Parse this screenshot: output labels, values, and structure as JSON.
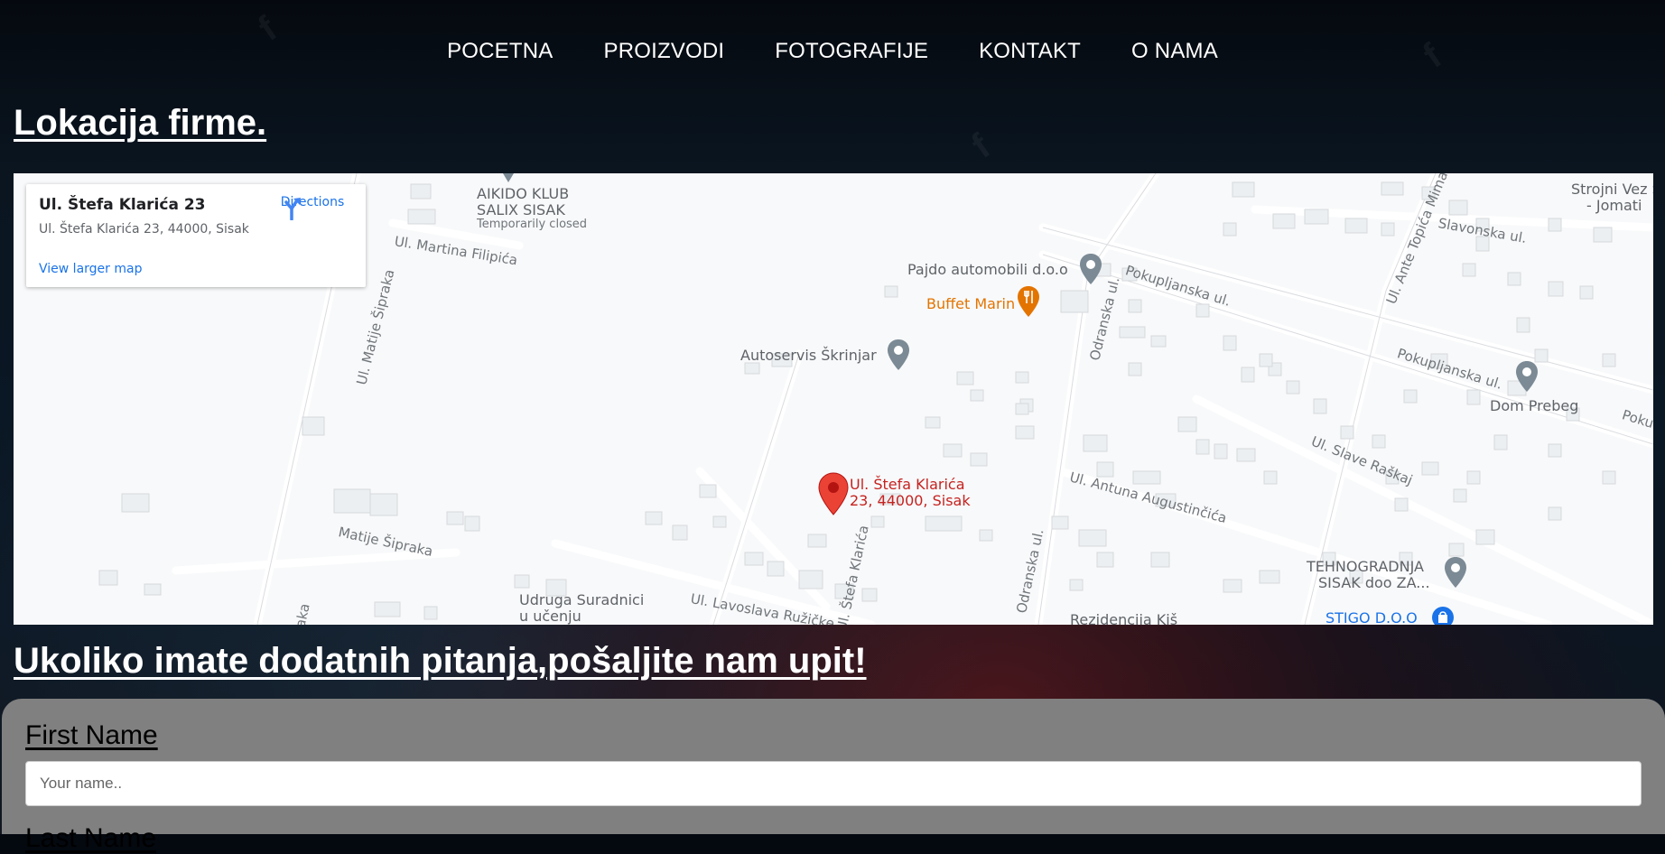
{
  "nav": {
    "items": [
      "POCETNA",
      "PROIZVODI",
      "FOTOGRAFIJE",
      "KONTAKT",
      "O NAMA"
    ]
  },
  "location_heading": "Lokacija firme.",
  "map": {
    "card": {
      "title": "Ul. Štefa Klarića 23",
      "address": "Ul. Štefa Klarića 23, 44000, Sisak",
      "directions": "Directions",
      "larger_map": "View larger map"
    },
    "pin_label_1": "Ul. Štefa Klarića",
    "pin_label_2": "23, 44000, Sisak",
    "places": {
      "aikido_1": "AIKIDO KLUB",
      "aikido_2": "SALIX SISAK",
      "aikido_status": "Temporarily closed",
      "pajdo": "Pajdo automobili d.o.o",
      "buffet": "Buffet Marin",
      "autoservis": "Autoservis Škrinjar",
      "dom_prebeg": "Dom Prebeg",
      "tehno_1": "TEHNOGRADNJA",
      "tehno_2": "SISAK doo ZA...",
      "stigo": "STIGO D.O.O",
      "udruga_1": "Udruga Suradnici",
      "udruga_2": "u učenju",
      "rezidencija": "Rezidencija Kiš",
      "strojni_1": "Strojni Vez S",
      "strojni_2": "- Jomati"
    },
    "streets": {
      "martina": "Ul. Martina Filipića",
      "matije_v": "Ul. Matije Šipraka",
      "matije": "Matije Šipraka",
      "odranska_1": "Odranska ul.",
      "odranska_2": "Odranska ul.",
      "pokupljanska_1": "Pokupljanska ul.",
      "pokupljanska_2": "Pokupljanska ul.",
      "pokupljanska_3": "Poku",
      "slavonska": "Slavonska ul.",
      "ante": "Ul. Ante Topića Mima",
      "slave": "Ul. Slave Raškaj",
      "antuna": "Ul. Antuna Augustinčića",
      "lavoslava": "Ul. Lavoslava Ružičke",
      "stefa": "Ul. Štefa Klarića",
      "raka": "raka"
    },
    "colors": {
      "pin": "#ea4335",
      "food": "#e37400",
      "poi_grey": "#7b8a95",
      "shop": "#1a73e8",
      "link": "#1a73e8"
    }
  },
  "inquiry_heading": "Ukoliko imate dodatnih pitanja,pošaljite nam upit!",
  "form": {
    "first_name_label": "First Name",
    "first_name_placeholder": "Your name..",
    "last_name_label": "Last Name"
  }
}
